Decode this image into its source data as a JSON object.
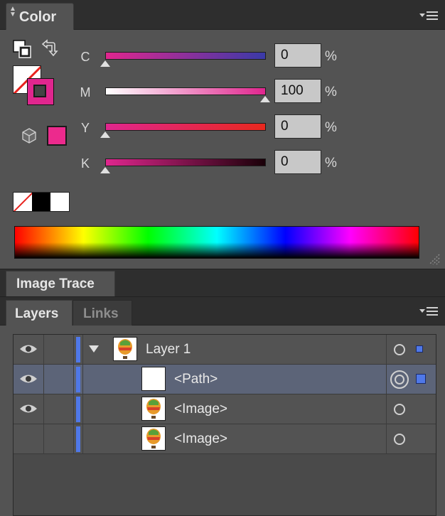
{
  "color_panel": {
    "title": "Color",
    "channels": [
      {
        "label": "C",
        "value": "0",
        "unit": "%",
        "slider_fraction": 0.0,
        "gradient_start": "#e0268e",
        "gradient_end": "#3a3aa8"
      },
      {
        "label": "M",
        "value": "100",
        "unit": "%",
        "slider_fraction": 1.0,
        "gradient_start": "#ffffff",
        "gradient_end": "#e0268e"
      },
      {
        "label": "Y",
        "value": "0",
        "unit": "%",
        "slider_fraction": 0.0,
        "gradient_start": "#e0268e",
        "gradient_end": "#e8281e"
      },
      {
        "label": "K",
        "value": "0",
        "unit": "%",
        "slider_fraction": 0.0,
        "gradient_start": "#e0268e",
        "gradient_end": "#1a0008"
      }
    ],
    "icons": {
      "fill_stroke_default": "default-fill-stroke-icon",
      "swap": "swap-fill-stroke-icon",
      "out_of_gamut": "out-of-web-gamut-cube-icon"
    },
    "colors": {
      "accent_magenta": "#ec2a8d",
      "none_slash": "#e8231f"
    }
  },
  "image_trace_panel": {
    "title": "Image Trace"
  },
  "layers_panel": {
    "tabs": [
      {
        "label": "Layers",
        "active": true
      },
      {
        "label": "Links",
        "active": false
      }
    ],
    "rows": [
      {
        "name": "Layer 1",
        "visible": true,
        "expanded": true,
        "thumbnail": "balloon",
        "selected": false
      },
      {
        "name": "<Path>",
        "visible": true,
        "thumbnail": "blank",
        "selected": true
      },
      {
        "name": "<Image>",
        "visible": true,
        "thumbnail": "balloon",
        "selected": false
      },
      {
        "name": "<Image>",
        "visible": false,
        "thumbnail": "balloon",
        "selected": false
      }
    ],
    "layer_color": "#4f78e8"
  }
}
